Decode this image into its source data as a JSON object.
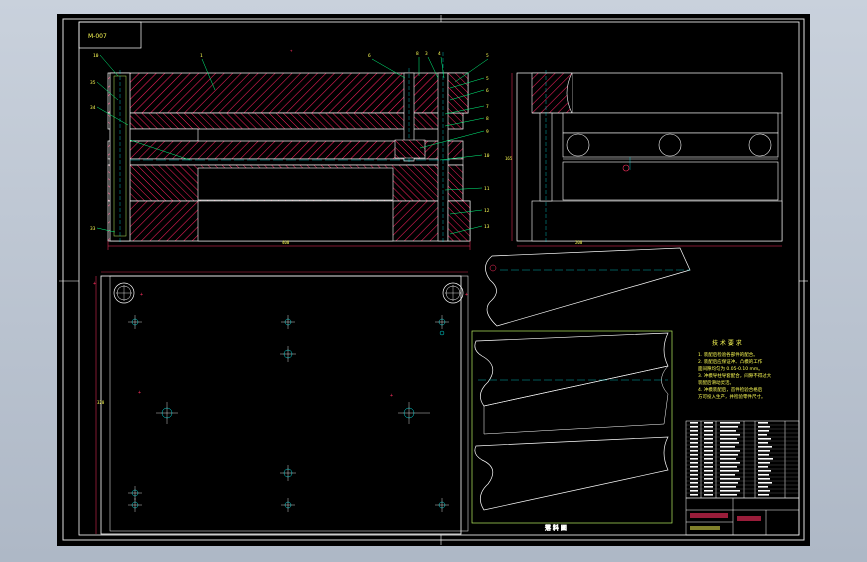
{
  "drawing": {
    "corner_box_label": "M-007",
    "plan_view_label": "落 料 图",
    "notes": {
      "heading": "技 术 要 求",
      "lines": [
        "1. 装配后检验各部件的配合。",
        "2. 装配后应保证冲、凸模的工作",
        "面间隙均匀为 0.05-0.10 mm。",
        "3. 冲模导柱导套配合，间隙不得过大",
        "装配后滑动灵活。",
        "4. 冲模装配后，首件检验合格后",
        "方可投入生产，并检验零件尺寸。"
      ]
    },
    "part_refs_top": [
      "10",
      "1",
      "6",
      "8",
      "3",
      "4",
      "5"
    ],
    "part_refs_left": [
      "35",
      "34",
      "33"
    ],
    "part_refs_right": [
      "5",
      "6",
      "7",
      "8",
      "9",
      "10",
      "11",
      "12",
      "13"
    ],
    "dimensions": {
      "section_width": "400",
      "side_width": "200",
      "plan_height": "320",
      "side_height": "165"
    },
    "colors": {
      "background": "#000000",
      "outer_frame": "#e0e0e0",
      "outline": "#ffffff",
      "hatch": "#ff2060",
      "label": "#ffff55",
      "leader": "#00ff80",
      "center_line": "#00e0e0",
      "part_outline": "#b8f060",
      "dimension": "#ff3060"
    }
  }
}
